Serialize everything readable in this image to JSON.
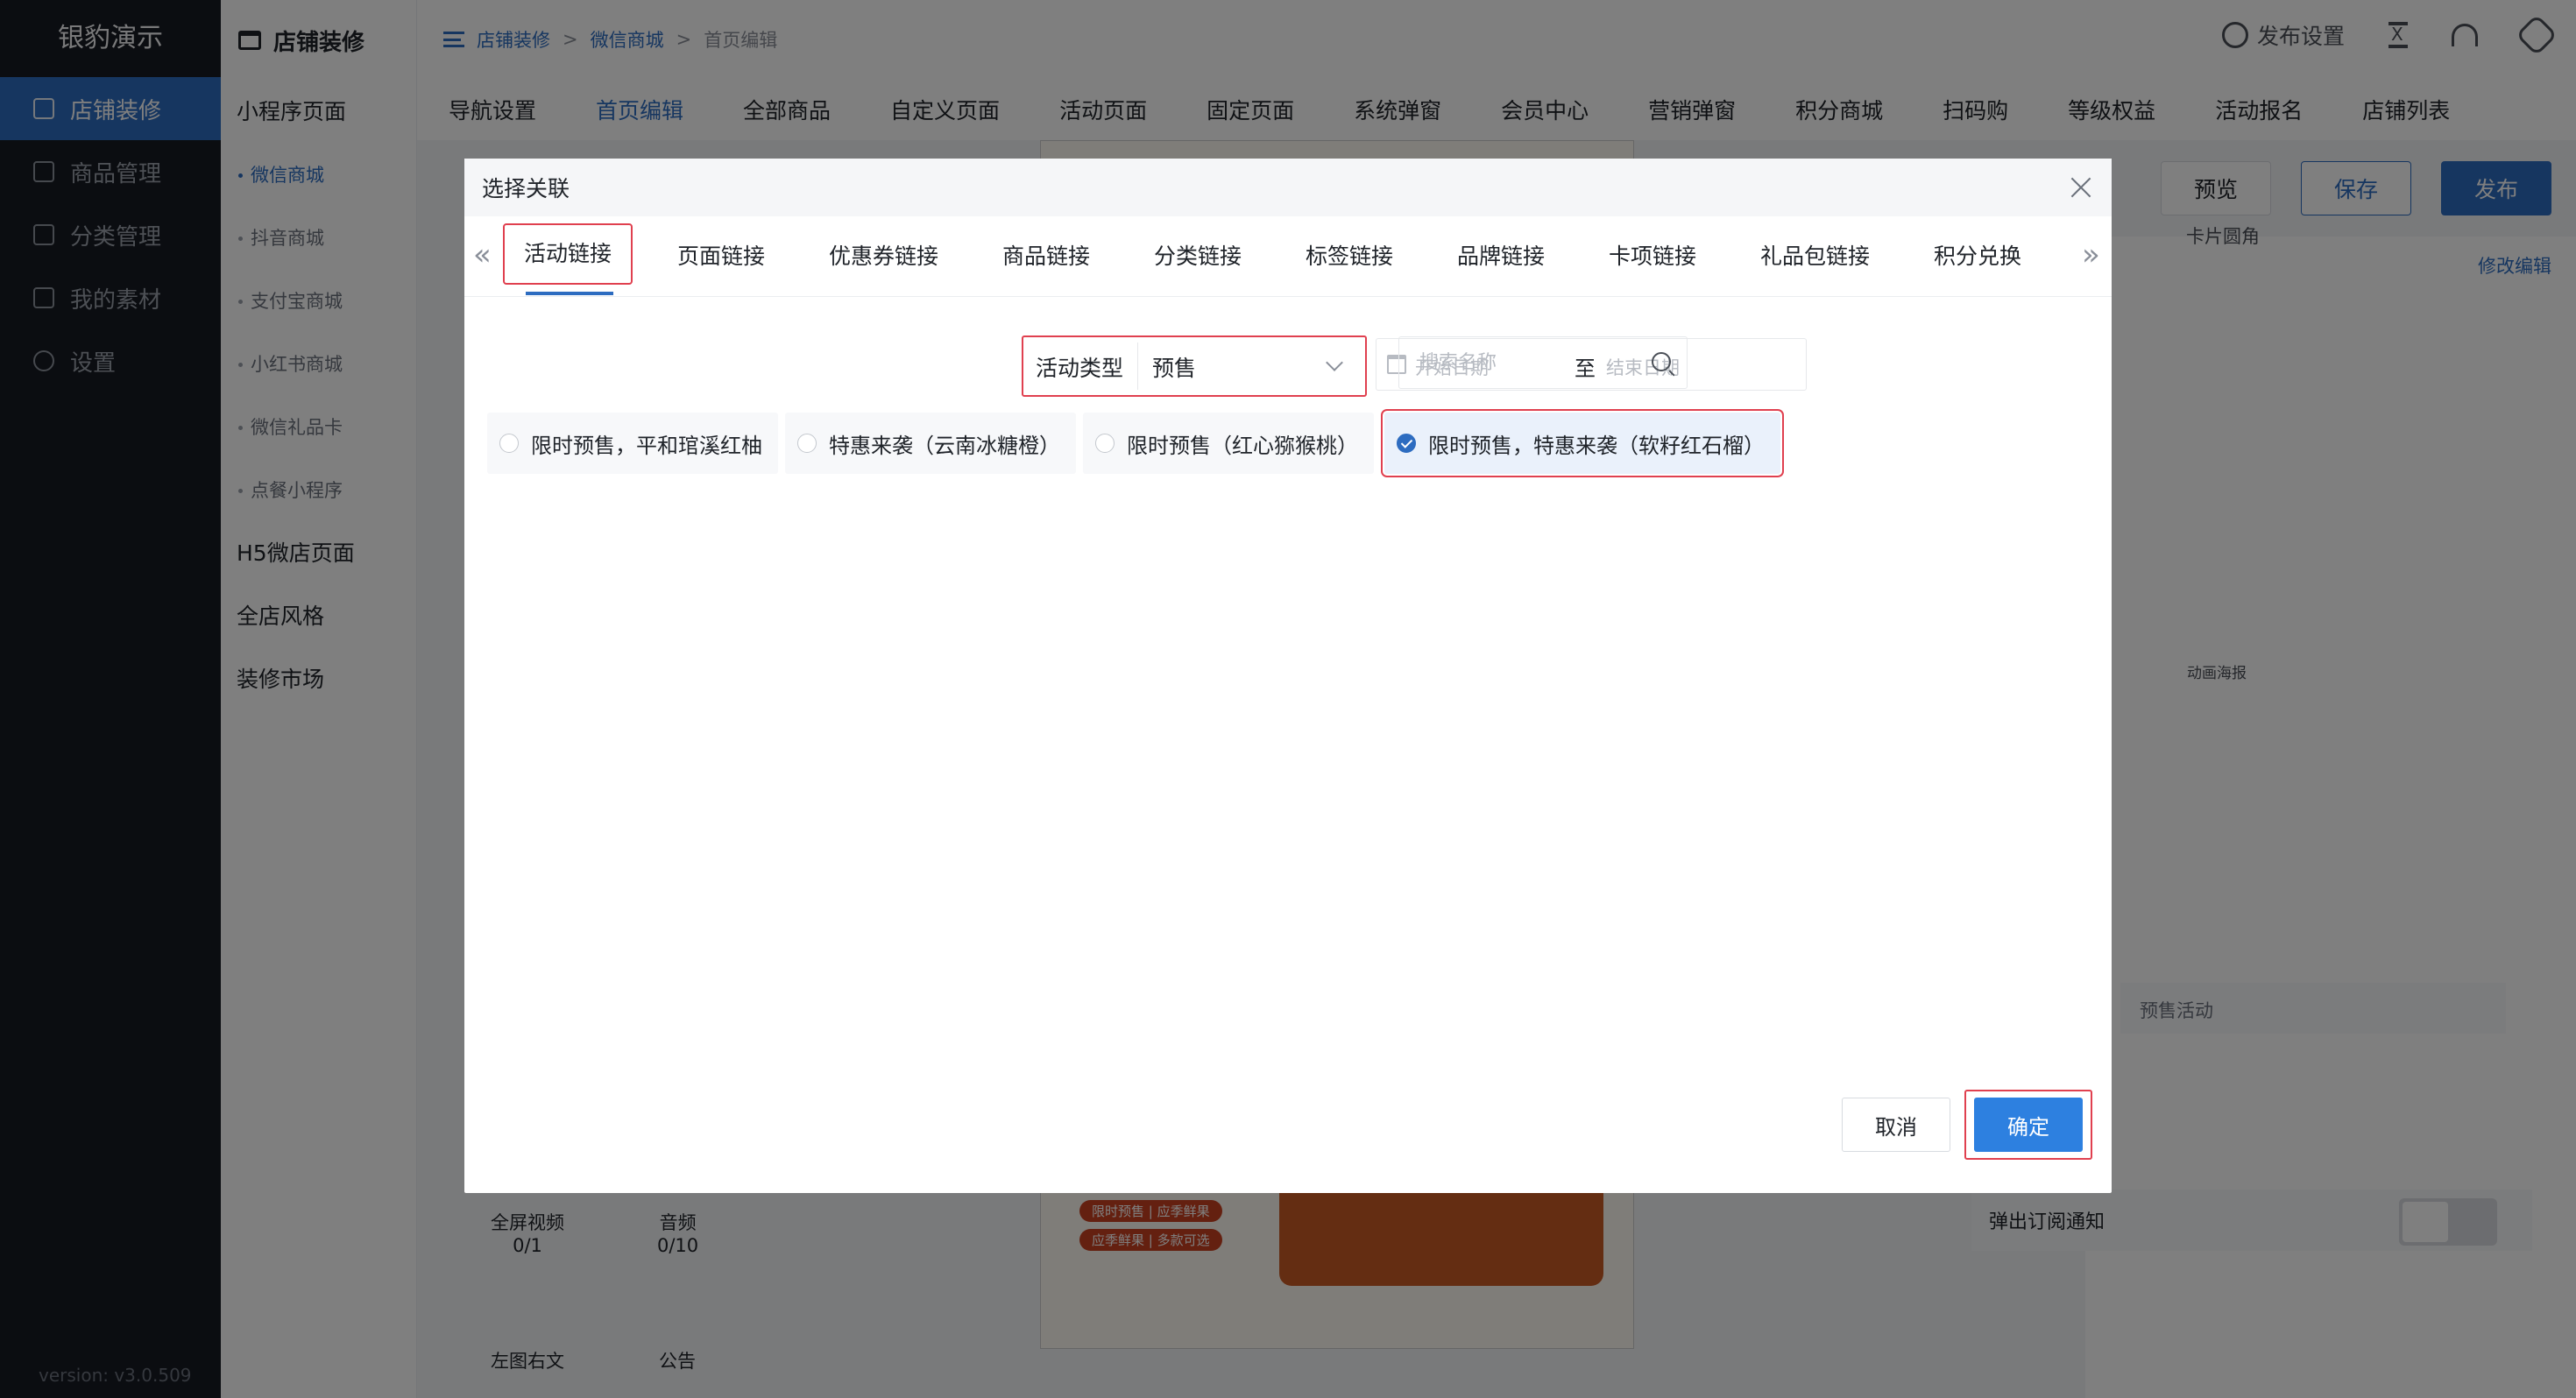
{
  "sidebar": {
    "brand": "银豹演示",
    "items": [
      {
        "label": "店铺装修",
        "active": true
      },
      {
        "label": "商品管理"
      },
      {
        "label": "分类管理"
      },
      {
        "label": "我的素材"
      },
      {
        "label": "设置"
      }
    ],
    "version": "version: v3.0.509"
  },
  "submenu": {
    "title": "店铺装修",
    "group1": "小程序页面",
    "items": [
      "微信商城",
      "抖音商城",
      "支付宝商城",
      "小红书商城",
      "微信礼品卡",
      "点餐小程序"
    ],
    "group2": "H5微店页面",
    "group3": "全店风格",
    "group4": "装修市场"
  },
  "breadcrumb": [
    "店铺装修",
    "微信商城",
    "首页编辑"
  ],
  "topbar": {
    "publish_settings": "发布设置"
  },
  "navtabs": [
    "导航设置",
    "首页编辑",
    "全部商品",
    "自定义页面",
    "活动页面",
    "固定页面",
    "系统弹窗",
    "会员中心",
    "营销弹窗",
    "积分商城",
    "扫码购",
    "等级权益",
    "活动报名",
    "店铺列表"
  ],
  "actions": {
    "preview": "预览",
    "save": "保存",
    "publish": "发布"
  },
  "background": {
    "edit_link": "修改编辑",
    "card_radius": "卡片圆角",
    "anim_poster": "动画海报",
    "preset_activity": "预售活动",
    "subscribe": "弹出订阅通知",
    "comp_video": "全屏视频",
    "comp_video_count": "0/1",
    "comp_audio": "音频",
    "comp_audio_count": "0/10",
    "comp_left": "左图右文",
    "comp_notice": "公告",
    "tag1": "限时预售 | 应季鲜果",
    "tag2": "应季鲜果 | 多款可选"
  },
  "modal": {
    "title": "选择关联",
    "tabs": [
      "活动链接",
      "页面链接",
      "优惠券链接",
      "商品链接",
      "分类链接",
      "标签链接",
      "品牌链接",
      "卡项链接",
      "礼品包链接",
      "积分兑换"
    ],
    "filter": {
      "type_label": "活动类型",
      "type_value": "预售",
      "start_placeholder": "开始日期",
      "to": "至",
      "end_placeholder": "结束日期",
      "search_placeholder": "搜索名称"
    },
    "options": [
      {
        "label": "限时预售，平和琯溪红柚",
        "checked": false
      },
      {
        "label": "特惠来袭（云南冰糖橙）",
        "checked": false
      },
      {
        "label": "限时预售（红心猕猴桃）",
        "checked": false
      },
      {
        "label": "限时预售，特惠来袭（软籽红石榴）",
        "checked": true
      }
    ],
    "cancel": "取消",
    "ok": "确定"
  }
}
